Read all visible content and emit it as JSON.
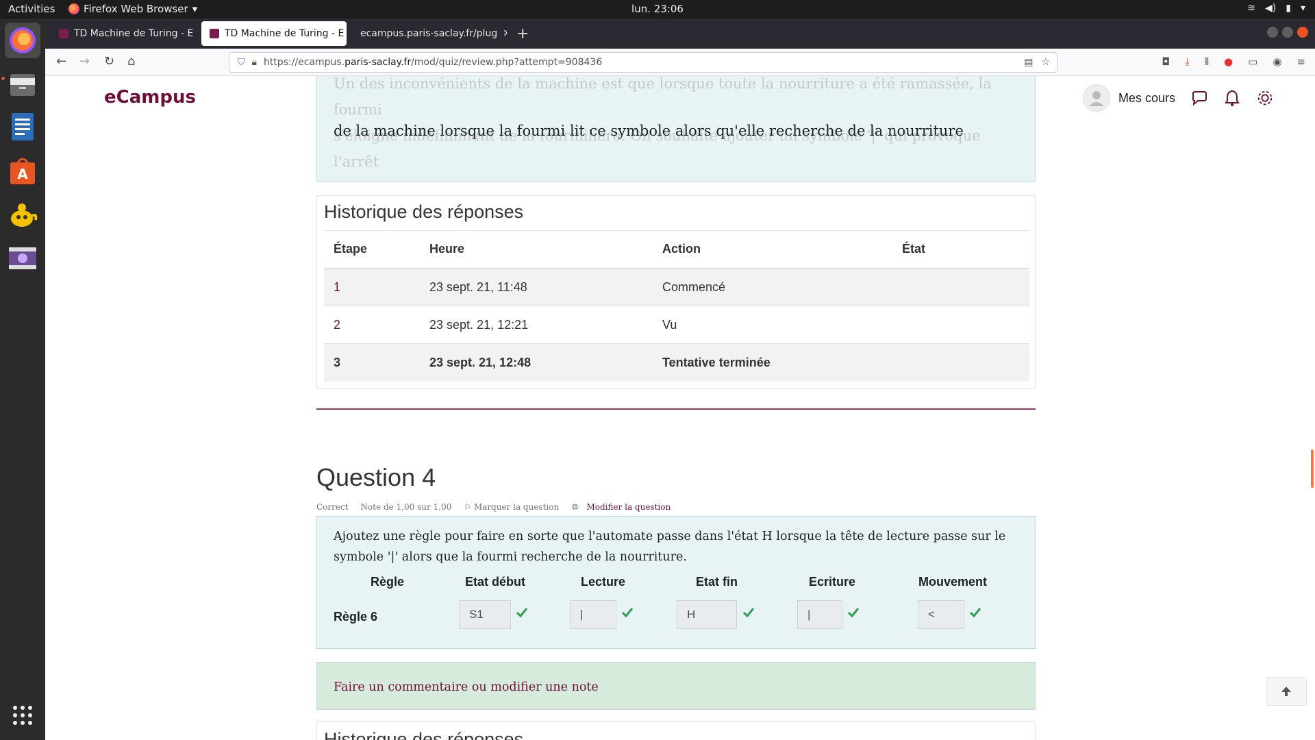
{
  "system": {
    "activities": "Activities",
    "app_name": "Firefox Web Browser",
    "clock": "lun. 23:06"
  },
  "browser": {
    "tabs": [
      {
        "title": "TD Machine de Turing - E"
      },
      {
        "title": "TD Machine de Turing - E"
      },
      {
        "title": "ecampus.paris-saclay.fr/plug"
      }
    ],
    "url_prefix": "https://ecampus.",
    "url_domain": "paris-saclay.fr",
    "url_path": "/mod/quiz/review.php?attempt=908436"
  },
  "header": {
    "brand": "eCampus",
    "mes_cours": "Mes cours"
  },
  "question3": {
    "faded_line1": "Un des inconvénients de la machine est que lorsque toute la nourriture a été ramassée, la fourmi",
    "faded_line2": "s'éloigne indéfiniment de la fourmilière. On souhaite ajouter un symbole '|' qui provoque l'arrêt",
    "visible_line": "de la machine lorsque la fourmi lit ce symbole alors qu'elle recherche de la nourriture"
  },
  "history": {
    "title": "Historique des réponses",
    "columns": [
      "Étape",
      "Heure",
      "Action",
      "État"
    ],
    "rows": [
      {
        "step": "1",
        "time": "23 sept. 21, 11:48",
        "action": "Commencé",
        "state": ""
      },
      {
        "step": "2",
        "time": "23 sept. 21, 12:21",
        "action": "Vu",
        "state": ""
      },
      {
        "step": "3",
        "time": "23 sept. 21, 12:48",
        "action": "Tentative terminée",
        "state": ""
      }
    ]
  },
  "question4": {
    "title": "Question 4",
    "status": "Correct",
    "grade": "Note de 1,00 sur 1,00",
    "flag": "Marquer la question",
    "edit": "Modifier la question",
    "text": "Ajoutez une règle pour faire en sorte que l'automate passe dans l'état H lorsque la tête de lecture passe sur le symbole '|' alors que la fourmi recherche de la nourriture.",
    "headers": [
      "Règle",
      "Etat début",
      "Lecture",
      "Etat fin",
      "Ecriture",
      "Mouvement"
    ],
    "rule_label": "Règle 6",
    "answers": {
      "etat_debut": "S1",
      "lecture": "|",
      "etat_fin": "H",
      "ecriture": "|",
      "mouvement": "<"
    },
    "comment_link": "Faire un commentaire ou modifier une note"
  },
  "history2": {
    "title": "Historique des réponses"
  },
  "colors": {
    "brand": "#6d0f3a",
    "question_bg": "#e7f3f5",
    "comment_bg": "#d7ebdc",
    "check": "#2e9e4f"
  }
}
